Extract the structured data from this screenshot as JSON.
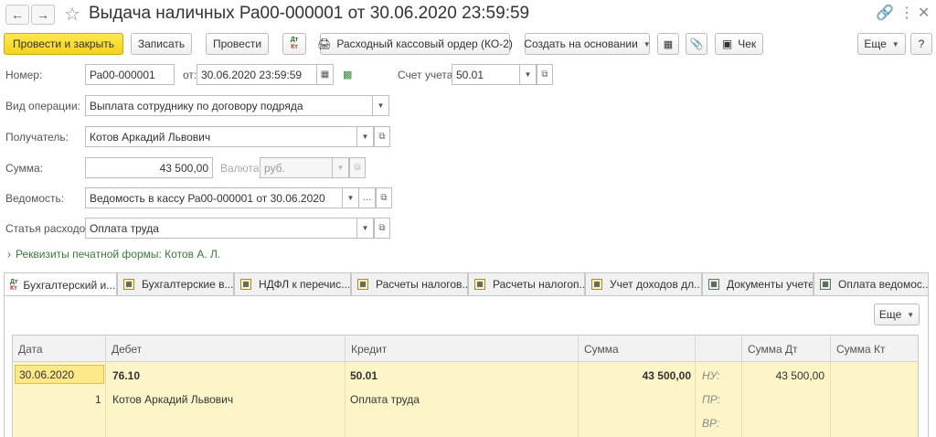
{
  "window": {
    "title": "Выдача наличных Ра00-000001 от 30.06.2020 23:59:59"
  },
  "toolbar": {
    "post_close": "Провести и закрыть",
    "save": "Записать",
    "post": "Провести",
    "cash_order": "Расходный кассовый ордер (КО-2)",
    "create_based": "Создать на основании",
    "check": "Чек",
    "more": "Еще",
    "help": "?",
    "dt_label": "Дт",
    "kt_label": "Кт"
  },
  "form": {
    "number_label": "Номер:",
    "number_value": "Ра00-000001",
    "date_label": "от:",
    "date_value": "30.06.2020 23:59:59",
    "account_label": "Счет учета:",
    "account_value": "50.01",
    "operation_label": "Вид операции:",
    "operation_value": "Выплата сотруднику по договору подряда",
    "recipient_label": "Получатель:",
    "recipient_value": "Котов Аркадий Львович",
    "amount_label": "Сумма:",
    "amount_value": "43 500,00",
    "currency_label": "Валюта:",
    "currency_value": "руб.",
    "statement_label": "Ведомость:",
    "statement_value": "Ведомость в кассу Ра00-000001 от 30.06.2020",
    "expense_label": "Статья расходов:",
    "expense_value": "Оплата труда",
    "print_link": "Реквизиты печатной формы: Котов А. Л."
  },
  "tabs": [
    {
      "label": "Бухгалтерский и..."
    },
    {
      "label": "Бухгалтерские в..."
    },
    {
      "label": "НДФЛ к перечис..."
    },
    {
      "label": "Расчеты налогов..."
    },
    {
      "label": "Расчеты налогоп..."
    },
    {
      "label": "Учет доходов дл..."
    },
    {
      "label": "Документы учете..."
    },
    {
      "label": "Оплата ведомос..."
    }
  ],
  "panel": {
    "more": "Еще"
  },
  "table": {
    "columns": [
      "Дата",
      "Дебет",
      "Кредит",
      "Сумма",
      "",
      "Сумма Дт",
      "Сумма Кт"
    ],
    "row": {
      "date": "30.06.2020",
      "num": "1",
      "debit": "76.10",
      "debit_sub": "Котов Аркадий Львович",
      "credit": "50.01",
      "credit_sub": "Оплата труда",
      "sum": "43 500,00",
      "nu": "НУ:",
      "pr": "ПР:",
      "vr": "ВР:",
      "sum_dt": "43 500,00"
    }
  }
}
